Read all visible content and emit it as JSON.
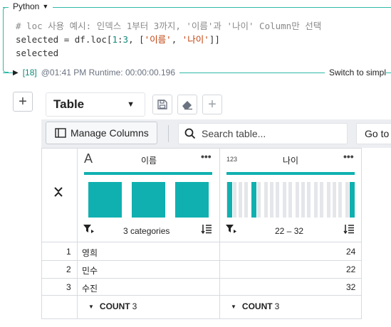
{
  "cell": {
    "language": "Python",
    "code": {
      "line1": "# loc 사용 예시: 인덱스 1부터 3까지, '이름'과 '나이' Column만 선택",
      "line2_prefix": "selected = df.loc[",
      "line2_n1": "1",
      "line2_colon": ":",
      "line2_n2": "3",
      "line2_mid": ", [",
      "line2_s1": "'이름'",
      "line2_comma": ", ",
      "line2_s2": "'나이'",
      "line2_end": "]]",
      "line3": "selected"
    },
    "execution_count": "[18]",
    "run_info": "@01:41 PM Runtime: 00:00:00.196",
    "switch_link": "Switch to simpl"
  },
  "toolbar": {
    "add_label": "+",
    "view_selected": "Table",
    "manage_columns": "Manage Columns",
    "search_placeholder": "Search table...",
    "goto_label": "Go to"
  },
  "table": {
    "columns": [
      {
        "name": "이름",
        "type_icon": "A",
        "summary": "3 categories",
        "footer": "COUNT",
        "footer_value": "3"
      },
      {
        "name": "나이",
        "type_icon": "123",
        "summary": "22 – 32",
        "footer": "COUNT",
        "footer_value": "3"
      }
    ],
    "rows": [
      {
        "index": "1",
        "name": "영희",
        "age": "24"
      },
      {
        "index": "2",
        "name": "민수",
        "age": "22"
      },
      {
        "index": "3",
        "name": "수진",
        "age": "32"
      }
    ]
  },
  "colors": {
    "accent": "#10b0b0",
    "cell_border": "#2fb8a8",
    "code_string": "#c2410c"
  }
}
